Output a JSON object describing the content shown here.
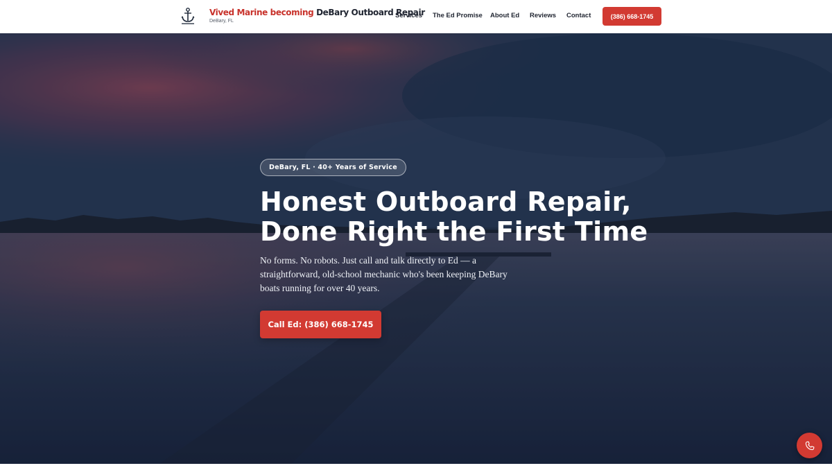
{
  "brand": {
    "title_red": "Vived Marine becoming",
    "title_dark": "DeBary Outboard Repair",
    "subtitle": "DeBary, FL",
    "logo_icon": "anchor-icon"
  },
  "nav": {
    "items": [
      {
        "label": "Services"
      },
      {
        "label": "The Ed Promise"
      },
      {
        "label": "About Ed"
      },
      {
        "label": "Reviews"
      },
      {
        "label": "Contact"
      }
    ],
    "cta_label": "(386) 668-1745"
  },
  "hero": {
    "badge": "DeBary, FL · 40+ Years of Service",
    "headline_line1": "Honest Outboard Repair,",
    "headline_line2": "Done Right the First Time",
    "lede": "No forms. No robots. Just call and talk directly to Ed — a straightforward, old-school mechanic who's been keeping DeBary boats running for over 40 years.",
    "cta_label": "Call Ed: (386) 668-1745"
  },
  "floating_button": {
    "icon": "phone-icon"
  },
  "colors": {
    "accent": "#d23a32",
    "text_dark": "#1f2430",
    "hero_sky": "#2b3f5c"
  }
}
